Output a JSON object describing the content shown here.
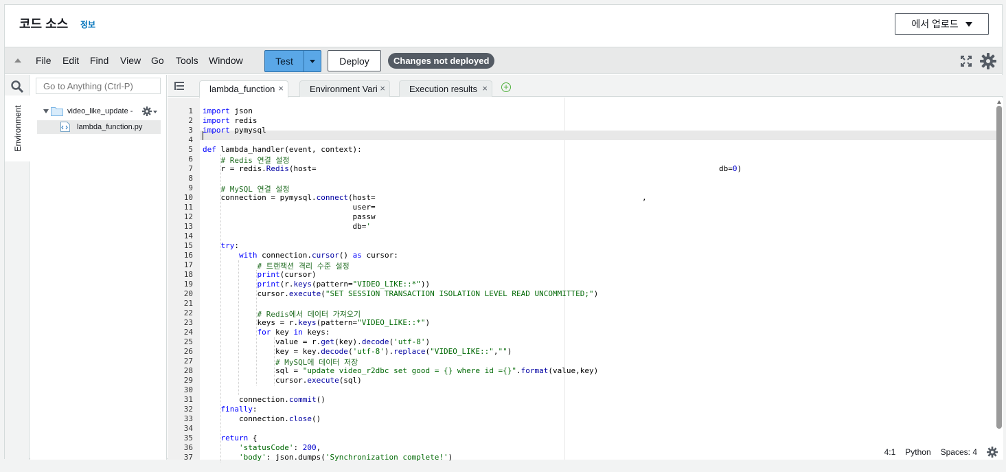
{
  "header": {
    "title": "코드 소스",
    "info_link": "정보",
    "upload_button": "에서 업로드"
  },
  "menu": {
    "items": [
      "File",
      "Edit",
      "Find",
      "View",
      "Go",
      "Tools",
      "Window"
    ],
    "test_button": "Test",
    "deploy_button": "Deploy",
    "status_badge": "Changes not deployed"
  },
  "sidebar": {
    "environment_tab": "Environment",
    "search_placeholder": "Go to Anything (Ctrl-P)",
    "folder_name": "video_like_update -",
    "file_name": "lambda_function.py"
  },
  "tabs": [
    {
      "label": "lambda_function",
      "active": true
    },
    {
      "label": "Environment Vari",
      "active": false
    },
    {
      "label": "Execution results",
      "active": false
    }
  ],
  "editor": {
    "line_numbers": [
      "1",
      "2",
      "3",
      "4",
      "5",
      "6",
      "7",
      "8",
      "9",
      "10",
      "11",
      "12",
      "13",
      "14",
      "15",
      "16",
      "17",
      "18",
      "19",
      "20",
      "21",
      "22",
      "23",
      "24",
      "25",
      "26",
      "27",
      "28",
      "29",
      "30",
      "31",
      "32",
      "33",
      "34",
      "35",
      "36",
      "37"
    ],
    "lines": [
      "import json",
      "import redis",
      "import pymysql",
      "",
      "def lambda_handler(event, context):",
      "    # Redis 연결 설정",
      "    r = redis.Redis(host=",
      "",
      "    # MySQL 연결 설정",
      "    connection = pymysql.connect(host=",
      "                                 user=",
      "                                 passw",
      "                                 db='",
      "",
      "    try:",
      "        with connection.cursor() as cursor:",
      "            # 트랜잭션 격리 수준 설정",
      "            print(cursor)",
      "            print(r.keys(pattern=\"VIDEO_LIKE::*\"))",
      "            cursor.execute(\"SET SESSION TRANSACTION ISOLATION LEVEL READ UNCOMMITTED;\")",
      "",
      "            # Redis에서 데이터 가져오기",
      "            keys = r.keys(pattern=\"VIDEO_LIKE::*\")",
      "            for key in keys:",
      "                value = r.get(key).decode('utf-8')",
      "                key = key.decode('utf-8').replace(\"VIDEO_LIKE::\",\"\")",
      "                # MySQL에 데이터 저장",
      "                sql = \"update video_r2dbc set good = {} where id ={}\".format(value,key)",
      "                cursor.execute(sql)",
      "",
      "        connection.commit()",
      "    finally:",
      "        connection.close()",
      "",
      "    return {",
      "        'statusCode': 200,",
      "        'body': json.dumps('Synchronization complete!')"
    ],
    "line7_tail": "db=0)",
    "line10_tail": ","
  },
  "status": {
    "position": "4:1",
    "language": "Python",
    "spaces": "Spaces: 4"
  }
}
